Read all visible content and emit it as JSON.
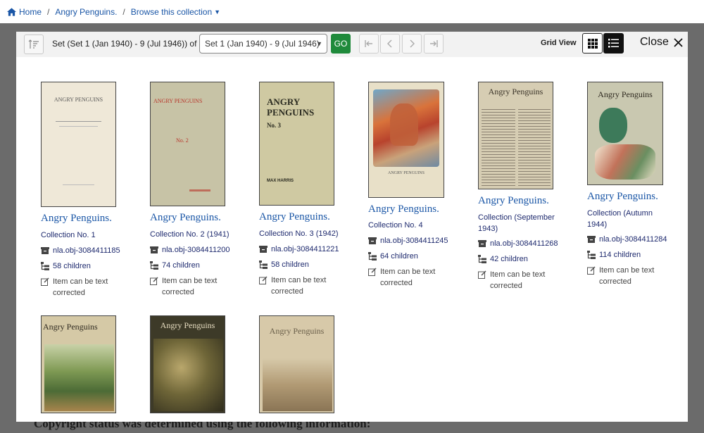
{
  "breadcrumb": {
    "home": "Home",
    "collection": "Angry Penguins.",
    "browse": "Browse this collection"
  },
  "background_text": "Copyright status was determined using the following information:",
  "toolbar": {
    "set_label": "Set (Set 1 (Jan 1940) - 9 (Jul 1946)) of 9",
    "select_value": "Set 1 (Jan 1940) - 9 (Jul 1946)",
    "go_label": "GO",
    "grid_view_label": "Grid View",
    "close_label": "Close"
  },
  "items": [
    {
      "title": "Angry Penguins.",
      "subtitle": "Collection No. 1",
      "id": "nla.obj-3084411185",
      "children": "58 children",
      "tc": "Item can be text corrected",
      "cover_text": "ANGRY PENGUINS"
    },
    {
      "title": "Angry Penguins.",
      "subtitle": "Collection No. 2 (1941)",
      "id": "nla.obj-3084411200",
      "children": "74 children",
      "tc": "Item can be text corrected",
      "cover_text": "ANGRY PENGUINS"
    },
    {
      "title": "Angry Penguins.",
      "subtitle": "Collection No. 3 (1942)",
      "id": "nla.obj-3084411221",
      "children": "58 children",
      "tc": "Item can be text corrected",
      "cover_text": "ANGRY PENGUINS"
    },
    {
      "title": "Angry Penguins.",
      "subtitle": "Collection No. 4",
      "id": "nla.obj-3084411245",
      "children": "64 children",
      "tc": "Item can be text corrected",
      "cover_text": "ANGRY PENGUINS"
    },
    {
      "title": "Angry Penguins.",
      "subtitle": "Collection (September 1943)",
      "id": "nla.obj-3084411268",
      "children": "42 children",
      "tc": "Item can be text corrected",
      "cover_text": "Angry Penguins"
    },
    {
      "title": "Angry Penguins.",
      "subtitle": "Collection (Autumn 1944)",
      "id": "nla.obj-3084411284",
      "children": "114 children",
      "tc": "Item can be text corrected",
      "cover_text": "Angry Penguins"
    },
    {
      "cover_text": "Angry Penguins"
    },
    {
      "cover_text": "Angry Penguins"
    },
    {
      "cover_text": "Angry Penguins"
    }
  ],
  "colors": {
    "link": "#1a56a6",
    "go_button": "#1f8a3b",
    "backdrop": "#6b6b6b"
  }
}
